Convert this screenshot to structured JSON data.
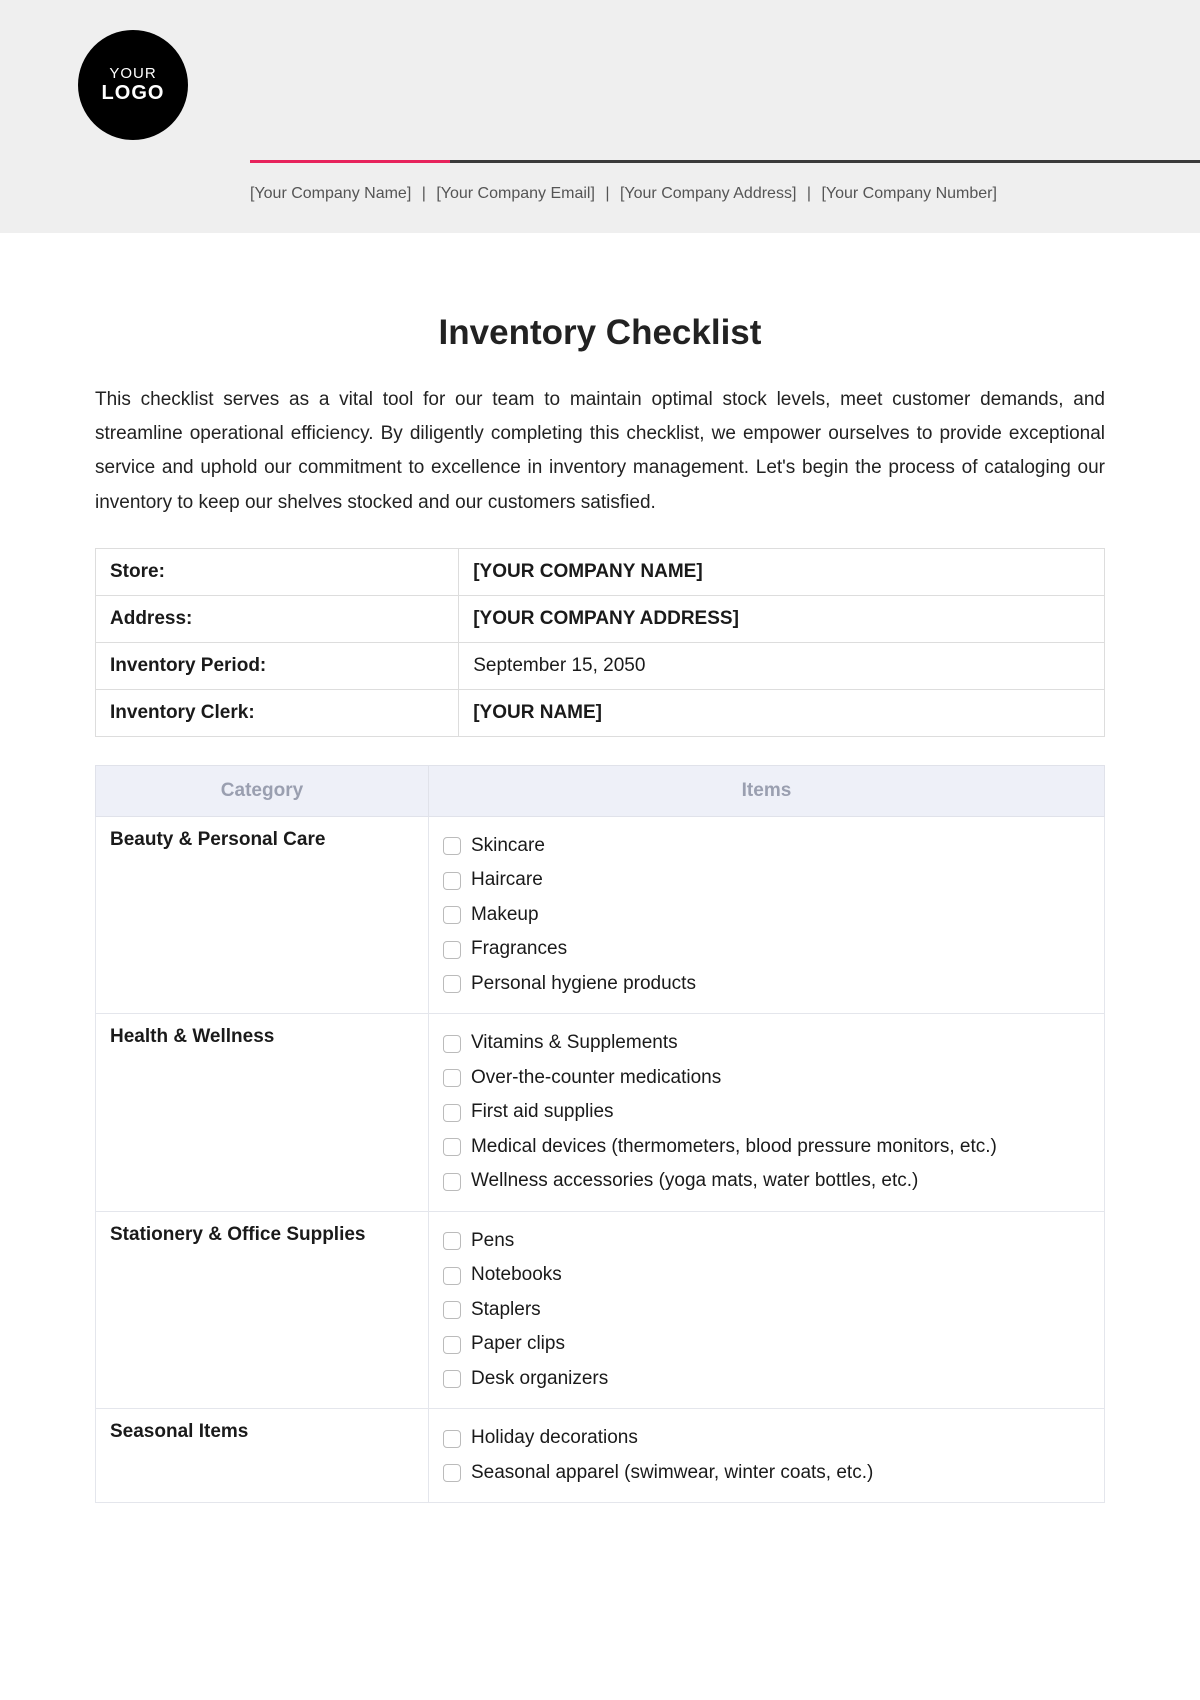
{
  "logo": {
    "line1": "YOUR",
    "line2": "LOGO"
  },
  "meta": {
    "company_name": "[Your Company Name]",
    "company_email": "[Your Company Email]",
    "company_address": "[Your Company Address]",
    "company_number": "[Your Company Number]"
  },
  "title": "Inventory Checklist",
  "intro": "This checklist serves as a vital tool for our team to maintain optimal stock levels, meet customer demands, and streamline operational efficiency. By diligently completing this checklist, we empower ourselves to provide exceptional service and uphold our commitment to excellence in inventory management. Let's begin the process of cataloging our inventory to keep our shelves stocked and our customers satisfied.",
  "info": {
    "store_label": "Store:",
    "store_value": "[YOUR COMPANY NAME]",
    "address_label": "Address:",
    "address_value": "[YOUR COMPANY ADDRESS]",
    "period_label": "Inventory Period:",
    "period_value": "September 15, 2050",
    "clerk_label": "Inventory Clerk:",
    "clerk_value": "[YOUR NAME]"
  },
  "checklist_headers": {
    "category": "Category",
    "items": "Items"
  },
  "categories": [
    {
      "name": "Beauty & Personal Care",
      "items": [
        "Skincare",
        "Haircare",
        "Makeup",
        "Fragrances",
        "Personal hygiene products"
      ]
    },
    {
      "name": "Health & Wellness",
      "items": [
        "Vitamins & Supplements",
        "Over-the-counter medications",
        "First aid supplies",
        "Medical devices (thermometers, blood pressure monitors, etc.)",
        "Wellness accessories (yoga mats, water bottles, etc.)"
      ]
    },
    {
      "name": "Stationery & Office Supplies",
      "items": [
        "Pens",
        "Notebooks",
        "Staplers",
        "Paper clips",
        "Desk organizers"
      ]
    },
    {
      "name": "Seasonal Items",
      "items": [
        "Holiday decorations",
        "Seasonal apparel (swimwear, winter coats, etc.)"
      ]
    }
  ]
}
